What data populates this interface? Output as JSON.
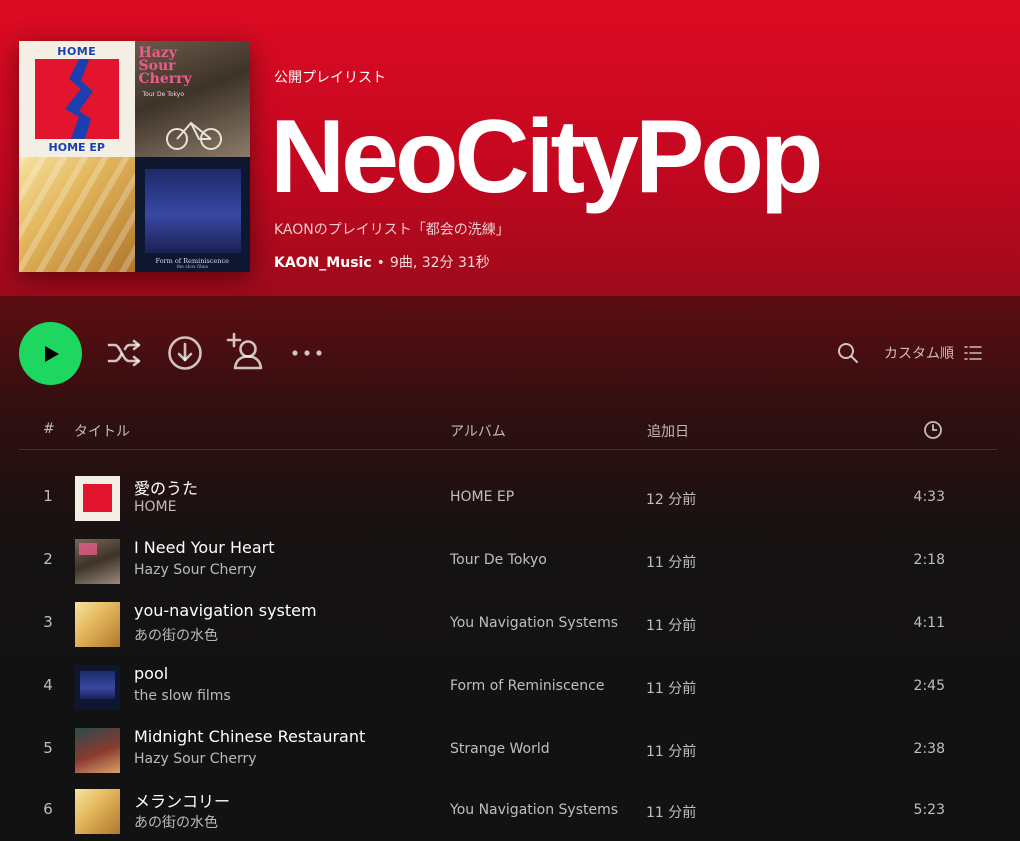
{
  "header": {
    "type_label": "公開プレイリスト",
    "title": "NeoCityPop",
    "description": "KAONのプレイリスト「都会の洗練」",
    "owner": "KAON_Music",
    "separator": "•",
    "stats": "9曲, 32分 31秒"
  },
  "cover": {
    "tiles": [
      {
        "top_text": "HOME",
        "bottom_text": "HOME EP"
      },
      {
        "title": "Hazy Sour Cherry",
        "subtitle": "Tour De Tokyo"
      },
      {},
      {
        "title": "Form of Reminiscence",
        "subtitle": "the slow films"
      }
    ]
  },
  "actions": {
    "sort_label": "カスタム順",
    "icons": [
      "play-icon",
      "shuffle-icon",
      "download-icon",
      "add-user-icon",
      "more-icon",
      "search-icon",
      "list-icon"
    ]
  },
  "table": {
    "columns": {
      "num": "#",
      "title": "タイトル",
      "album": "アルバム",
      "added": "追加日",
      "duration_icon": "clock-icon"
    },
    "tracks": [
      {
        "num": "1",
        "title": "愛のうた",
        "artist": "HOME",
        "album": "HOME EP",
        "added": "12 分前",
        "duration": "4:33"
      },
      {
        "num": "2",
        "title": "I Need Your Heart",
        "artist": "Hazy Sour Cherry",
        "album": "Tour De Tokyo",
        "added": "11 分前",
        "duration": "2:18"
      },
      {
        "num": "3",
        "title": "you-navigation system",
        "artist": "あの街の水色",
        "album": "You Navigation Systems",
        "added": "11 分前",
        "duration": "4:11"
      },
      {
        "num": "4",
        "title": "pool",
        "artist": "the slow films",
        "album": "Form of Reminiscence",
        "added": "11 分前",
        "duration": "2:45"
      },
      {
        "num": "5",
        "title": "Midnight Chinese Restaurant",
        "artist": "Hazy Sour Cherry",
        "album": "Strange World",
        "added": "11 分前",
        "duration": "2:38"
      },
      {
        "num": "6",
        "title": "メランコリー",
        "artist": "あの街の水色",
        "album": "You Navigation Systems",
        "added": "11 分前",
        "duration": "5:23"
      }
    ]
  },
  "colors": {
    "header_red": "#dc0b22",
    "play_green": "#1ed760",
    "background": "#121212"
  }
}
